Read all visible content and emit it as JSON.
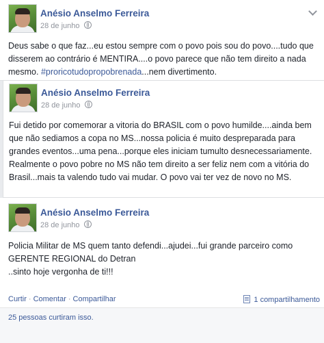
{
  "posts": [
    {
      "author": "Anésio Anselmo Ferreira",
      "date": "28 de junho",
      "text_before": "Deus sabe o que faz...eu estou sempre com o povo pois sou do povo....tudo que disserem ao contrário é MENTIRA....o povo parece que não tem direito a nada mesmo. ",
      "hashtag": "#proricotudopropobrenada",
      "text_after": "...nem divertimento."
    },
    {
      "author": "Anésio Anselmo Ferreira",
      "date": "28 de junho",
      "text": "Fui detido por comemorar a vitoria do BRASIL com o povo humilde....ainda bem que não sediamos a copa no MS...nossa policia é muito despreparada para grandes eventos...uma pena...porque eles iniciam tumulto desnecessariamente. Realmente o povo pobre no MS não tem direito a ser feliz nem com a vitória do Brasil...mais ta valendo tudo vai mudar. O povo vai ter vez de novo no MS."
    },
    {
      "author": "Anésio Anselmo Ferreira",
      "date": "28 de junho",
      "text_line1": "Policia Militar de MS quem tanto defendi...ajudei...fui grande parceiro como GERENTE REGIONAL do Detran",
      "text_line2": "..sinto hoje vergonha de ti!!!"
    }
  ],
  "actions": {
    "like": "Curtir",
    "comment": "Comentar",
    "share": "Compartilhar",
    "separator": "·",
    "share_count": "1 compartilhamento"
  },
  "likes_summary": "25 pessoas curtiram isso."
}
